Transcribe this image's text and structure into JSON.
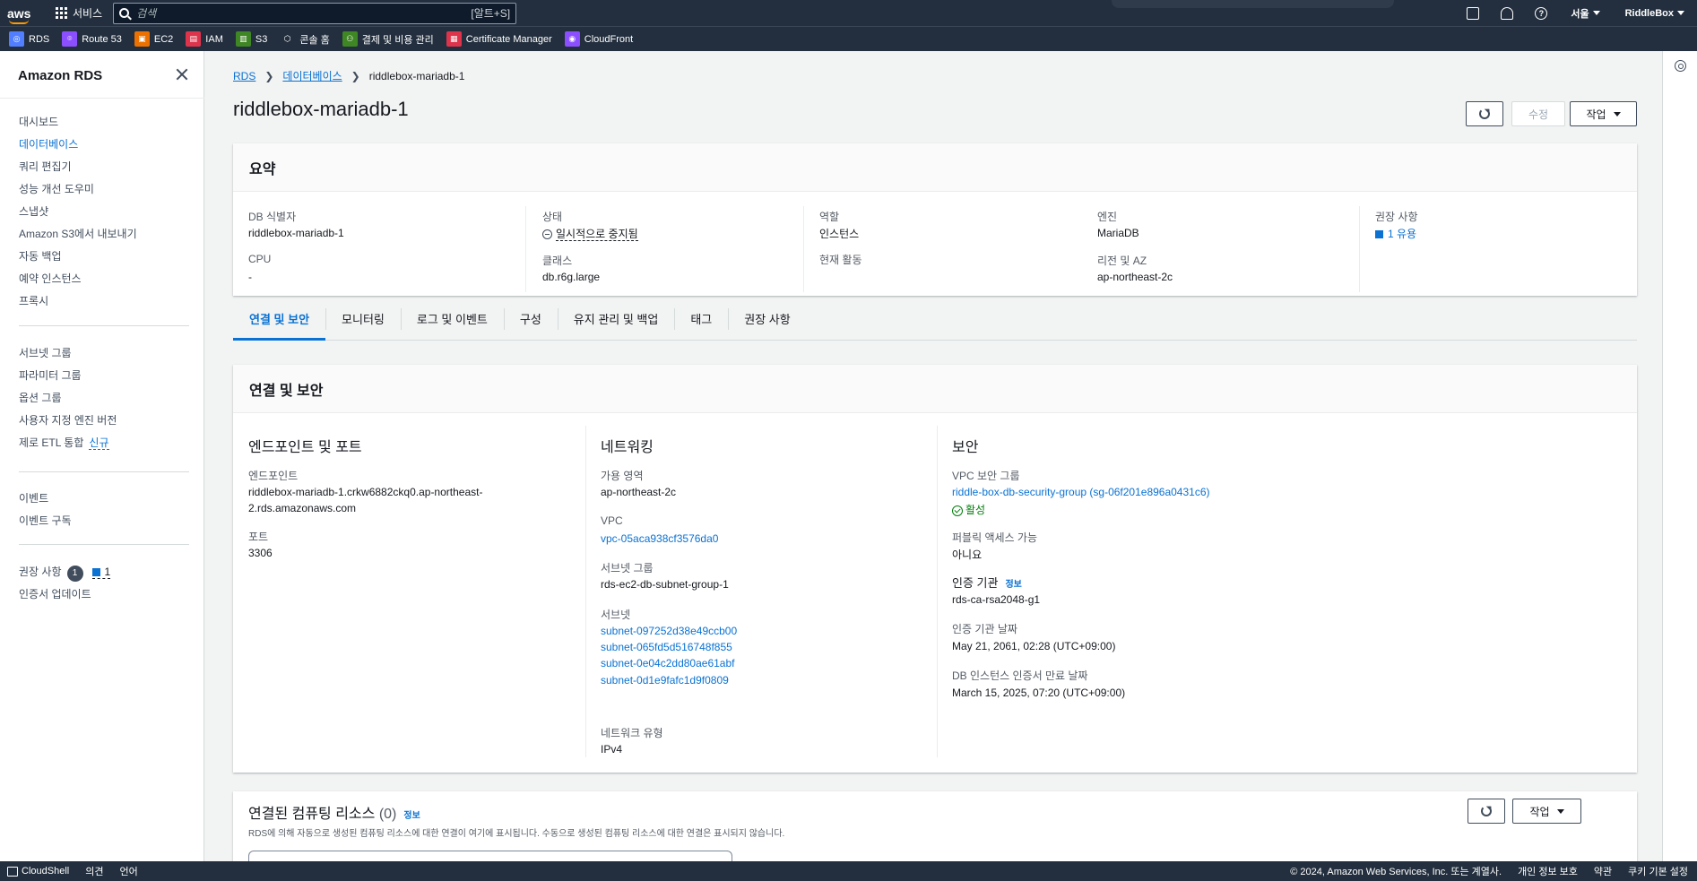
{
  "topbar": {
    "logo": "aws",
    "services_label": "서비스",
    "search_placeholder": "검색",
    "search_shortcut": "[알트+S]",
    "help_glyph": "?",
    "region": "서울",
    "account": "RiddleBox"
  },
  "favorites": [
    {
      "label": "RDS",
      "color": "#527fff",
      "glyph": "◎"
    },
    {
      "label": "Route 53",
      "color": "#8c4fff",
      "glyph": "⌾"
    },
    {
      "label": "EC2",
      "color": "#ed7100",
      "glyph": "▣"
    },
    {
      "label": "IAM",
      "color": "#dd344c",
      "glyph": "▤"
    },
    {
      "label": "S3",
      "color": "#3f8624",
      "glyph": "▥"
    },
    {
      "label": "콘솔 홈",
      "color": "#232f3e",
      "glyph": "⬡"
    },
    {
      "label": "결제 및 비용 관리",
      "color": "#3f8624",
      "glyph": "⚇"
    },
    {
      "label": "Certificate Manager",
      "color": "#dd344c",
      "glyph": "▦"
    },
    {
      "label": "CloudFront",
      "color": "#8c4fff",
      "glyph": "◉"
    }
  ],
  "sidebar": {
    "title": "Amazon RDS",
    "group1": [
      "대시보드",
      "데이터베이스",
      "쿼리 편집기",
      "성능 개선 도우미",
      "스냅샷",
      "Amazon S3에서 내보내기",
      "자동 백업",
      "예약 인스턴스",
      "프록시"
    ],
    "active_item": "데이터베이스",
    "group2": [
      "서브넷 그룹",
      "파라미터 그룹",
      "옵션 그룹",
      "사용자 지정 엔진 버전",
      "제로 ETL 통합"
    ],
    "new_badge": "신규",
    "group3": [
      "이벤트",
      "이벤트 구독"
    ],
    "recommendations_label": "권장 사항",
    "recommendations_count": "1",
    "recommendations_link": "1",
    "cert_update": "인증서 업데이트"
  },
  "breadcrumb": {
    "root": "RDS",
    "parent": "데이터베이스",
    "current": "riddlebox-mariadb-1"
  },
  "page": {
    "title": "riddlebox-mariadb-1",
    "modify_label": "수정",
    "actions_label": "작업"
  },
  "summary": {
    "header": "요약",
    "db_id_label": "DB 식별자",
    "db_id": "riddlebox-mariadb-1",
    "cpu_label": "CPU",
    "cpu": "-",
    "status_label": "상태",
    "status": "일시적으로 중지됨",
    "class_label": "클래스",
    "class": "db.r6g.large",
    "role_label": "역할",
    "role": "인스턴스",
    "activity_label": "현재 활동",
    "activity": "",
    "engine_label": "엔진",
    "engine": "MariaDB",
    "region_label": "리전 및 AZ",
    "region": "ap-northeast-2c",
    "recommend_label": "권장 사항",
    "recommend": "1 유용"
  },
  "tabs": [
    "연결 및 보안",
    "모니터링",
    "로그 및 이벤트",
    "구성",
    "유지 관리 및 백업",
    "태그",
    "권장 사항"
  ],
  "active_tab": "연결 및 보안",
  "connectivity": {
    "header": "연결 및 보안",
    "endpoint_section": "엔드포인트 및 포트",
    "endpoint_label": "엔드포인트",
    "endpoint_line1": "riddlebox-mariadb-1.crkw6882ckq0.ap-northeast-",
    "endpoint_line2": "2.rds.amazonaws.com",
    "port_label": "포트",
    "port": "3306",
    "networking_section": "네트워킹",
    "az_label": "가용 영역",
    "az": "ap-northeast-2c",
    "vpc_label": "VPC",
    "vpc": "vpc-05aca938cf3576da0",
    "subnet_group_label": "서브넷 그룹",
    "subnet_group": "rds-ec2-db-subnet-group-1",
    "subnets_label": "서브넷",
    "subnets": [
      "subnet-097252d38e49ccb00",
      "subnet-065fd5d516748f855",
      "subnet-0e04c2dd80ae61abf",
      "subnet-0d1e9fafc1d9f0809"
    ],
    "network_type_label": "네트워크 유형",
    "network_type": "IPv4",
    "security_section": "보안",
    "vpc_sg_label": "VPC 보안 그룹",
    "vpc_sg": "riddle-box-db-security-group (sg-06f201e896a0431c6)",
    "vpc_sg_status": "활성",
    "public_label": "퍼블릭 액세스 가능",
    "public": "아니요",
    "ca_label": "인증 기관",
    "ca_info": "정보",
    "ca": "rds-ca-rsa2048-g1",
    "ca_date_label": "인증 기관 날짜",
    "ca_date": "May 21, 2061, 02:28 (UTC+09:00)",
    "cert_exp_label": "DB 인스턴스 인증서 만료 날짜",
    "cert_exp": "March 15, 2025, 07:20 (UTC+09:00)"
  },
  "compute": {
    "title": "연결된 컴퓨팅 리소스",
    "count": "(0)",
    "info": "정보",
    "description": "RDS에 의해 자동으로 생성된 컴퓨팅 리소스에 대한 연결이 여기에 표시됩니다. 수동으로 생성된 컴퓨팅 리소스에 대한 연결은 표시되지 않습니다.",
    "actions_label": "작업"
  },
  "footer": {
    "cloudshell": "CloudShell",
    "feedback": "의견",
    "language": "언어",
    "copyright": "© 2024, Amazon Web Services, Inc. 또는 계열사.",
    "privacy": "개인 정보 보호",
    "terms": "약관",
    "cookies": "쿠키 기본 설정"
  }
}
